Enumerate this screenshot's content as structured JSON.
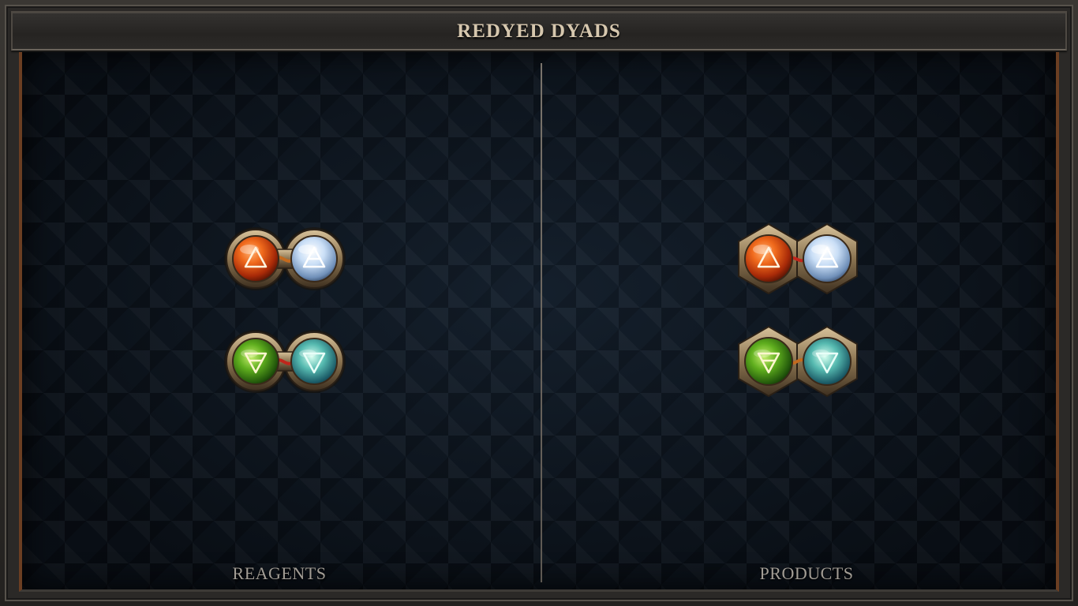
{
  "window": {
    "title": "REDYED DYADS"
  },
  "panels": {
    "left_label": "REAGENTS",
    "right_label": "PRODUCTS"
  },
  "colors": {
    "fire": "#e0561a",
    "air": "#b8d4f2",
    "earth": "#57a020",
    "water": "#4fb6b0",
    "frame_gold": "#b69a6e",
    "title_text": "#d6c7ae"
  },
  "dyads": {
    "reagents": [
      {
        "frame": "round",
        "link": "orange",
        "left": "fire-symbol-icon",
        "right": "air-symbol-icon"
      },
      {
        "frame": "round",
        "link": "red",
        "left": "earth-symbol-icon",
        "right": "water-symbol-icon"
      }
    ],
    "products": [
      {
        "frame": "hexagon",
        "link": "red",
        "left": "fire-symbol-icon",
        "right": "air-symbol-icon"
      },
      {
        "frame": "hexagon",
        "link": "orange",
        "left": "earth-symbol-icon",
        "right": "water-symbol-icon"
      }
    ]
  }
}
